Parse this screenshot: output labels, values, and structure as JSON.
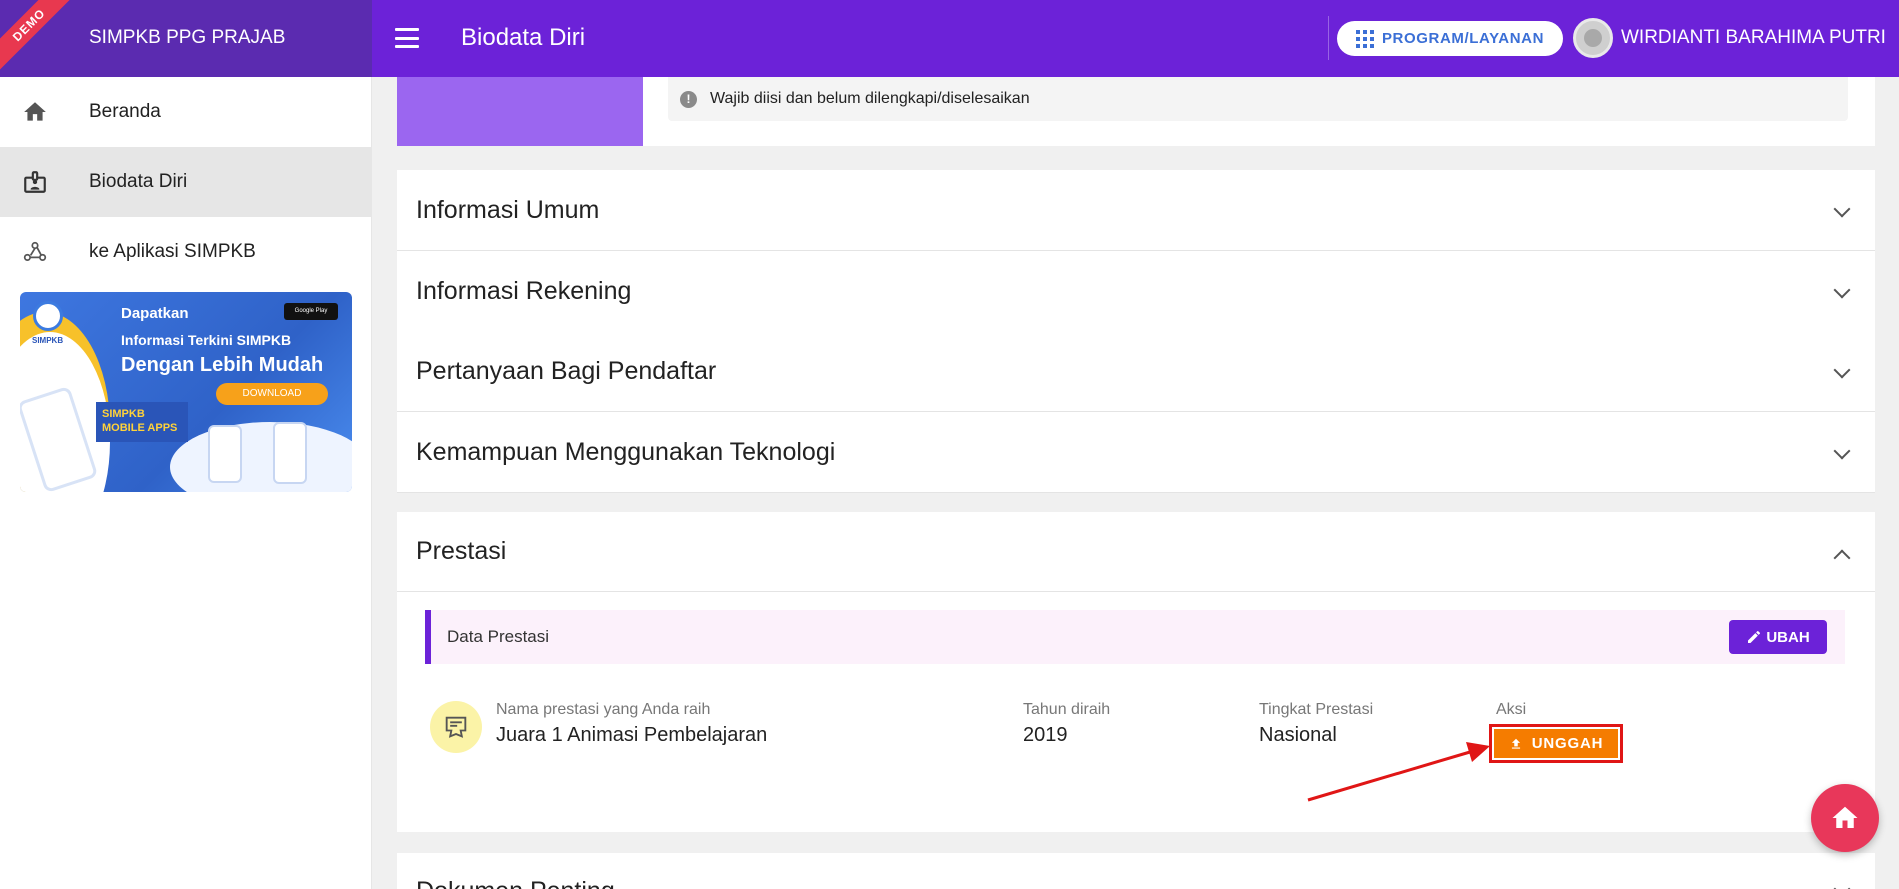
{
  "app": {
    "title": "SIMPKB PPG PRAJAB",
    "ribbon": "DEMO"
  },
  "header": {
    "page_title": "Biodata Diri",
    "program_button": "PROGRAM/LAYANAN",
    "user_name": "WIRDIANTI BARAHIMA PUTRI"
  },
  "sidebar": {
    "items": [
      {
        "label": "Beranda",
        "icon": "home-icon",
        "active": false
      },
      {
        "label": "Biodata Diri",
        "icon": "badge-icon",
        "active": true
      },
      {
        "label": "ke Aplikasi SIMPKB",
        "icon": "webhook-icon",
        "active": false
      }
    ],
    "banner": {
      "logo_text": "SIMPKB",
      "line1": "Dapatkan",
      "line2": "Informasi Terkini SIMPKB",
      "line3": "Dengan Lebih Mudah",
      "download": "DOWNLOAD",
      "mobile": "SIMPKB MOBILE APPS",
      "store": "Google Play"
    }
  },
  "notice": "Wajib diisi dan belum dilengkapi/diselesaikan",
  "panels": [
    {
      "title": "Informasi Umum"
    },
    {
      "title": "Informasi Rekening"
    },
    {
      "title": "Pertanyaan Bagi Pendaftar"
    },
    {
      "title": "Kemampuan Menggunakan Teknologi"
    }
  ],
  "prestasi": {
    "title": "Prestasi",
    "bar_label": "Data Prestasi",
    "edit_button": "UBAH",
    "columns": {
      "name": "Nama prestasi yang Anda raih",
      "year": "Tahun diraih",
      "level": "Tingkat Prestasi",
      "action": "Aksi"
    },
    "row": {
      "name": "Juara 1 Animasi Pembelajaran",
      "year": "2019",
      "level": "Nasional"
    },
    "upload_button": "UNGGAH"
  },
  "next_panel": "Dokumen Penting",
  "colors": {
    "primary": "#6c22d8",
    "accent": "#f57c00",
    "highlight": "#e01616",
    "fab": "#e8375a"
  }
}
